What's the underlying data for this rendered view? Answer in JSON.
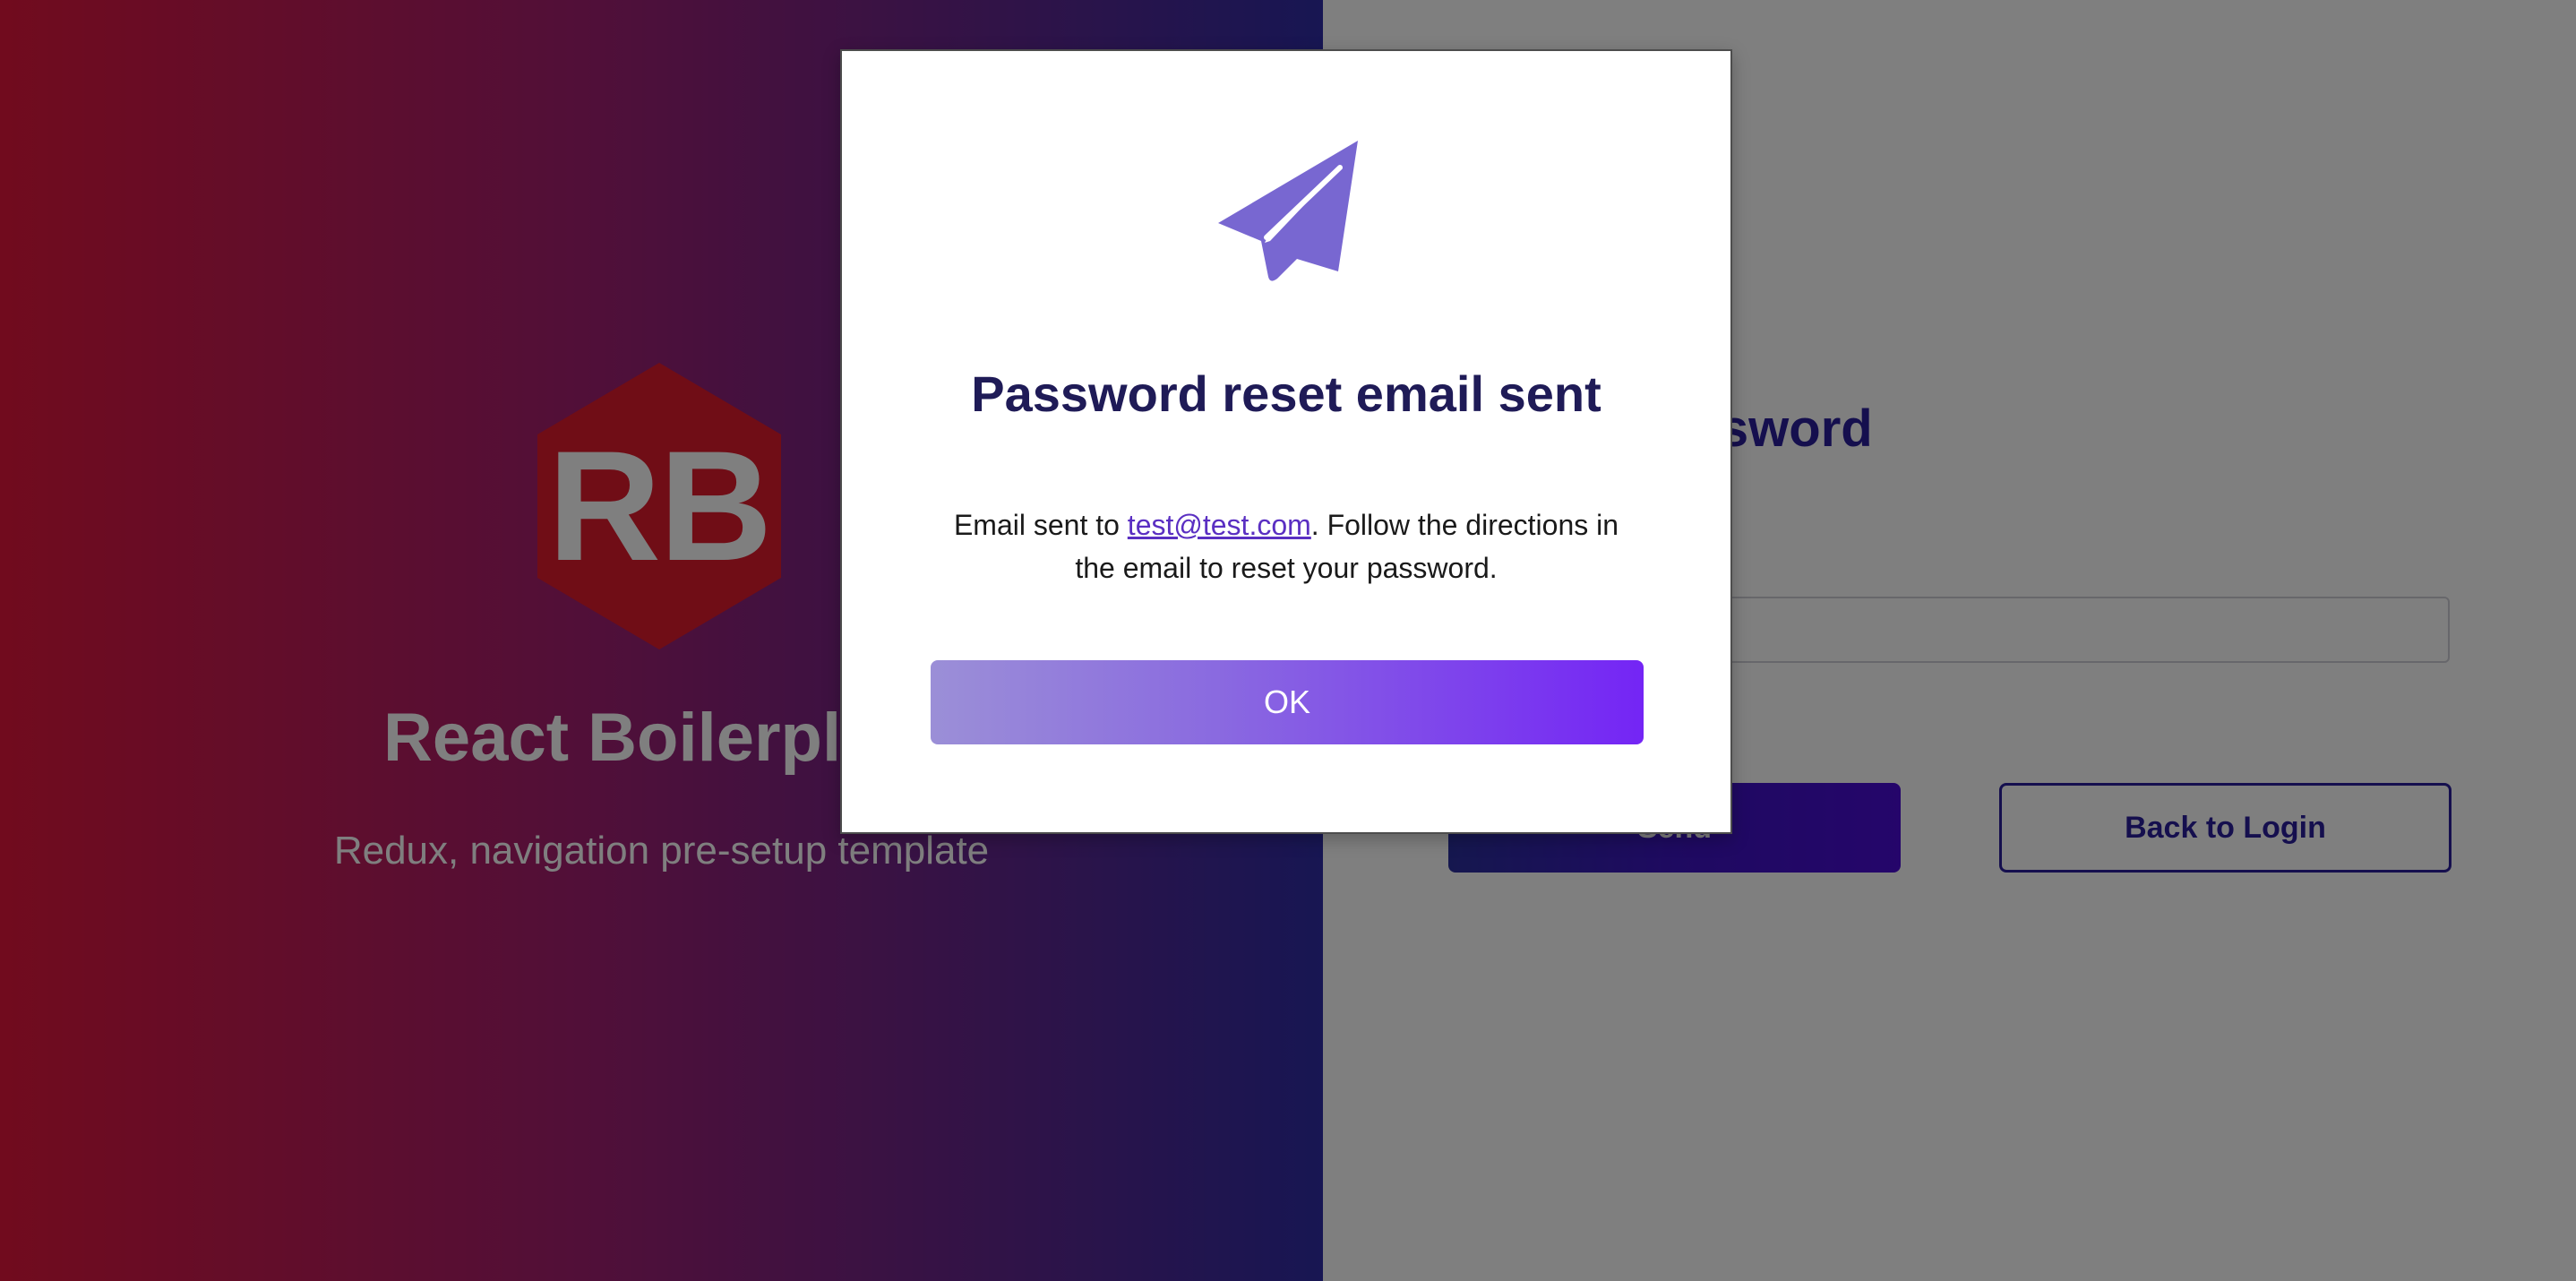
{
  "hero": {
    "logo_text": "RB",
    "title": "React Boilerplate",
    "subtitle": "Redux, navigation pre-setup template"
  },
  "form": {
    "title": "Forgot Password",
    "email_value": "",
    "send_label": "Send",
    "back_label": "Back to Login"
  },
  "modal": {
    "icon": "paper-plane-icon",
    "title": "Password reset email sent",
    "message_prefix": "Email sent to ",
    "email": "test@test.com",
    "message_suffix": ". Follow the directions in the email to reset your password.",
    "ok_label": "OK"
  },
  "colors": {
    "accent": "#7425f5",
    "icon": "#7867d1",
    "heading": "#1f1b57",
    "hex": "#e01a2c"
  }
}
